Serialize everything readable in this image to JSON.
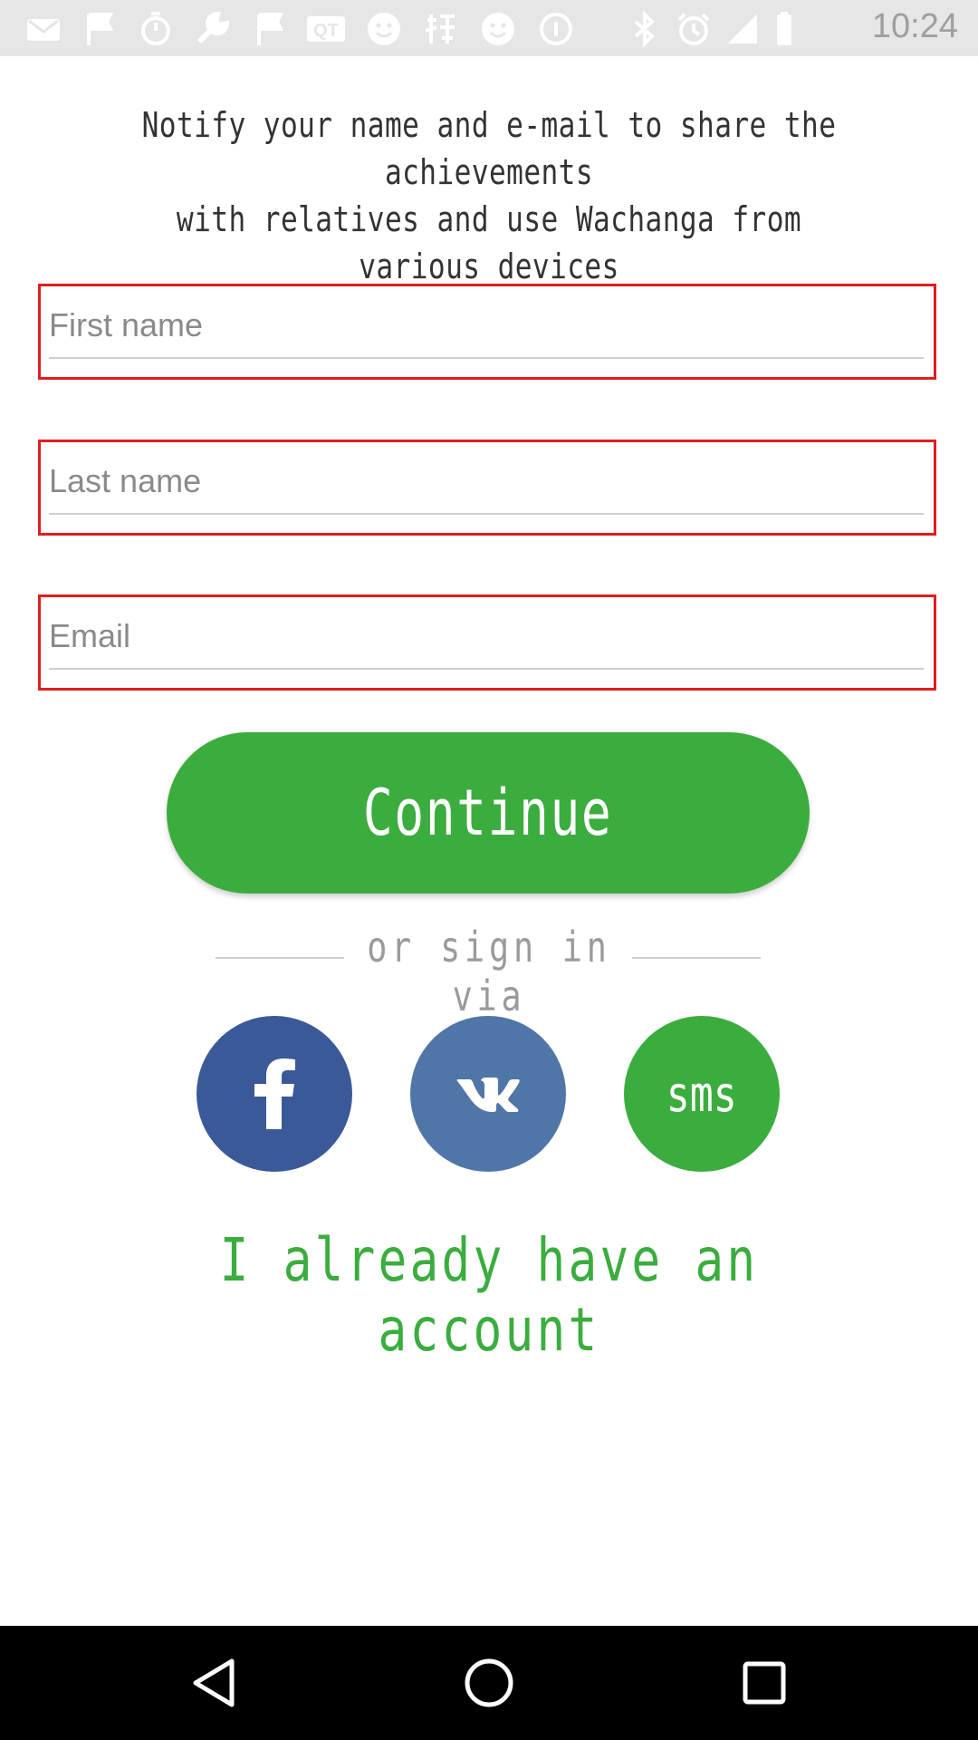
{
  "status_bar": {
    "time": "10:24",
    "icons": [
      "mail-icon",
      "flag-icon",
      "timer-icon",
      "wrench-icon",
      "flag-icon",
      "qt-icon",
      "smiley-icon",
      "japanese-icon",
      "smiley-icon",
      "info-icon",
      "bluetooth-icon",
      "alarm-icon",
      "signal-icon",
      "battery-icon"
    ],
    "qt_text": "QT"
  },
  "intro": {
    "text": "Notify your name and e-mail to share the achievements\nwith relatives and use Wachanga from various devices"
  },
  "form": {
    "first_name": {
      "value": "",
      "placeholder": "First name"
    },
    "last_name": {
      "value": "",
      "placeholder": "Last name"
    },
    "email": {
      "value": "",
      "placeholder": "Email"
    },
    "error_border_color": "#e11d1d"
  },
  "continue_button": {
    "label": "Continue",
    "color": "#3bad3e"
  },
  "sign_in_via": {
    "label": "or sign in via",
    "providers": [
      {
        "name": "facebook-icon",
        "color": "#3b5998"
      },
      {
        "name": "vk-icon",
        "color": "#5076a8"
      },
      {
        "name": "sms",
        "label": "sms",
        "color": "#3bad3e"
      }
    ]
  },
  "account_link": {
    "label": "I already have an account"
  },
  "nav_bar": {
    "buttons": [
      "back-icon",
      "home-icon",
      "recents-icon"
    ]
  }
}
